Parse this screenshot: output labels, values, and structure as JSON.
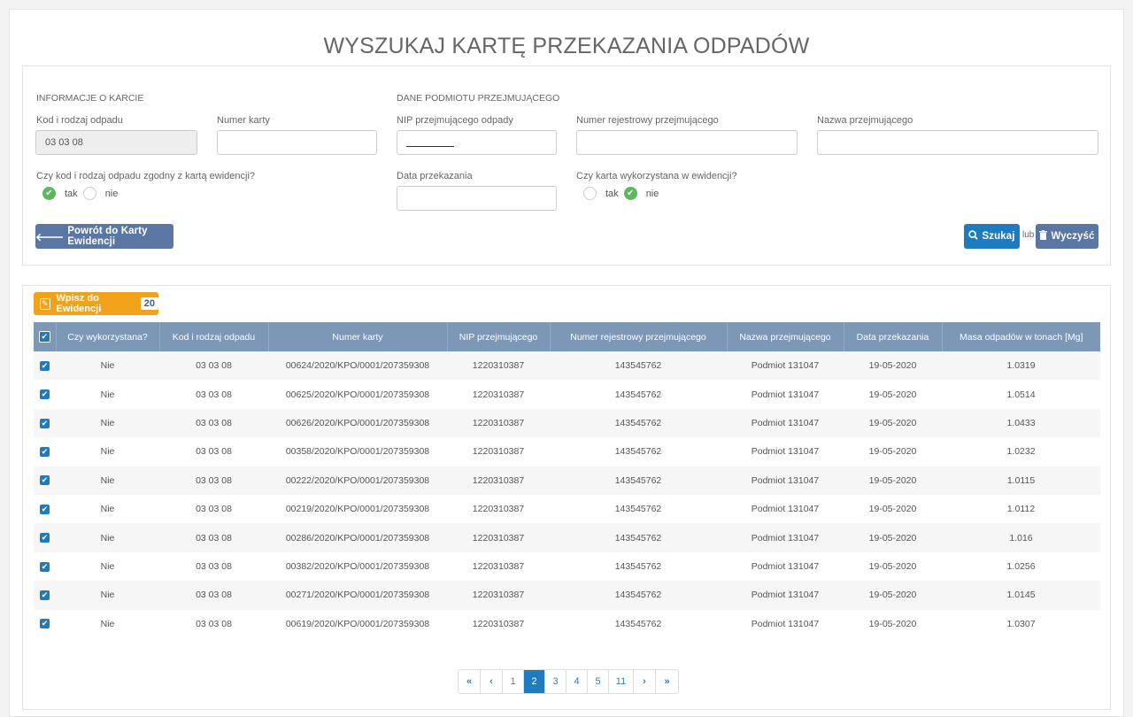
{
  "title": "WYSZUKAJ KARTĘ PRZEKAZANIA ODPADÓW",
  "form": {
    "section_card": "INFORMACJE O KARCIE",
    "section_receiver": "DANE PODMIOTU PRZEJMUJĄCEGO",
    "waste_code_label": "Kod i rodzaj odpadu",
    "waste_code_value": "03 03 08",
    "card_number_label": "Numer karty",
    "card_number_value": "",
    "nip_label": "NIP przejmującego odpady",
    "reg_number_label": "Numer rejestrowy przejmującego",
    "reg_number_value": "",
    "receiver_name_label": "Nazwa przejmującego",
    "receiver_name_value": "",
    "consistent_question": "Czy kod i rodzaj odpadu zgodny z kartą ewidencji?",
    "consistent_yes": "tak",
    "consistent_no": "nie",
    "transfer_date_label": "Data przekazania",
    "transfer_date_value": "",
    "used_question": "Czy karta wykorzystana w ewidencji?",
    "used_yes": "tak",
    "used_no": "nie",
    "back_button": "Powrót do Karty Ewidencji",
    "search_button": "Szukaj",
    "or_text": "lub",
    "clear_button": "Wyczyść"
  },
  "table": {
    "add_button": "Wpisz do Ewidencji",
    "add_count": "20",
    "columns": [
      "Czy wykorzystana?",
      "Kod i rodzaj odpadu",
      "Numer karty",
      "NIP przejmującego",
      "Numer rejestrowy przejmującego",
      "Nazwa przejmującego",
      "Data przekazania",
      "Masa odpadów w tonach [Mg]"
    ],
    "rows": [
      [
        "Nie",
        "03 03 08",
        "00624/2020/KPO/0001/207359308",
        "1220310387",
        "143545762",
        "Podmiot 131047",
        "19-05-2020",
        "1.0319"
      ],
      [
        "Nie",
        "03 03 08",
        "00625/2020/KPO/0001/207359308",
        "1220310387",
        "143545762",
        "Podmiot 131047",
        "19-05-2020",
        "1.0514"
      ],
      [
        "Nie",
        "03 03 08",
        "00626/2020/KPO/0001/207359308",
        "1220310387",
        "143545762",
        "Podmiot 131047",
        "19-05-2020",
        "1.0433"
      ],
      [
        "Nie",
        "03 03 08",
        "00358/2020/KPO/0001/207359308",
        "1220310387",
        "143545762",
        "Podmiot 131047",
        "19-05-2020",
        "1.0232"
      ],
      [
        "Nie",
        "03 03 08",
        "00222/2020/KPO/0001/207359308",
        "1220310387",
        "143545762",
        "Podmiot 131047",
        "19-05-2020",
        "1.0115"
      ],
      [
        "Nie",
        "03 03 08",
        "00219/2020/KPO/0001/207359308",
        "1220310387",
        "143545762",
        "Podmiot 131047",
        "19-05-2020",
        "1.0112"
      ],
      [
        "Nie",
        "03 03 08",
        "00286/2020/KPO/0001/207359308",
        "1220310387",
        "143545762",
        "Podmiot 131047",
        "19-05-2020",
        "1.016"
      ],
      [
        "Nie",
        "03 03 08",
        "00382/2020/KPO/0001/207359308",
        "1220310387",
        "143545762",
        "Podmiot 131047",
        "19-05-2020",
        "1.0256"
      ],
      [
        "Nie",
        "03 03 08",
        "00271/2020/KPO/0001/207359308",
        "1220310387",
        "143545762",
        "Podmiot 131047",
        "19-05-2020",
        "1.0145"
      ],
      [
        "Nie",
        "03 03 08",
        "00619/2020/KPO/0001/207359308",
        "1220310387",
        "143545762",
        "Podmiot 131047",
        "19-05-2020",
        "1.0307"
      ]
    ]
  },
  "pagination": {
    "first": "«",
    "prev": "‹",
    "pages": [
      "1",
      "2",
      "3",
      "4",
      "5",
      "11"
    ],
    "active": "2",
    "next": "›",
    "last": "»"
  },
  "icons": {
    "back": "arrow-left-icon",
    "search": "search-icon",
    "clear": "trash-icon",
    "add": "edit-icon",
    "checkbox": "check-icon"
  },
  "colors": {
    "primary": "#1f7bbf",
    "secondary": "#5a77a4",
    "warning": "#f0a21b",
    "success": "#5cb85c",
    "table_header": "#7d97b7"
  }
}
